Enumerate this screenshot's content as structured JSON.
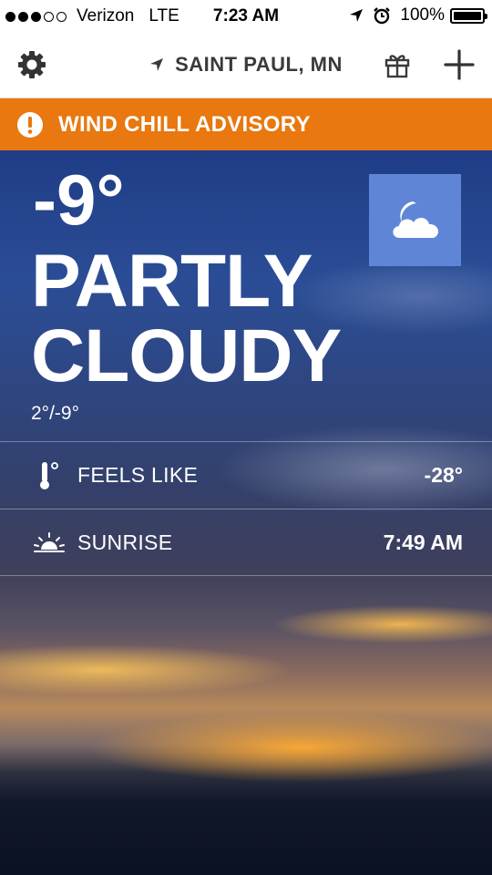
{
  "status_bar": {
    "carrier": "Verizon",
    "network": "LTE",
    "time": "7:23 AM",
    "battery": "100%",
    "signal_bars_filled": 3,
    "signal_bars_total": 5
  },
  "nav": {
    "location": "SAINT PAUL, MN",
    "icons": [
      "gear-icon",
      "location-arrow-icon",
      "gift-icon",
      "plus-icon"
    ]
  },
  "advisory": {
    "text": "WIND CHILL ADVISORY",
    "color": "#e8780f"
  },
  "current": {
    "temp": "-9°",
    "condition_line1": "PARTLY",
    "condition_line2": "CLOUDY",
    "hi_lo": "2°/-9°",
    "icon": "moon-cloud-icon",
    "icon_box_color": "#5f86d6"
  },
  "details": [
    {
      "label": "FEELS LIKE",
      "value": "-28°",
      "icon": "thermometer-icon"
    },
    {
      "label": "SUNRISE",
      "value": "7:49 AM",
      "icon": "sunrise-icon"
    }
  ]
}
